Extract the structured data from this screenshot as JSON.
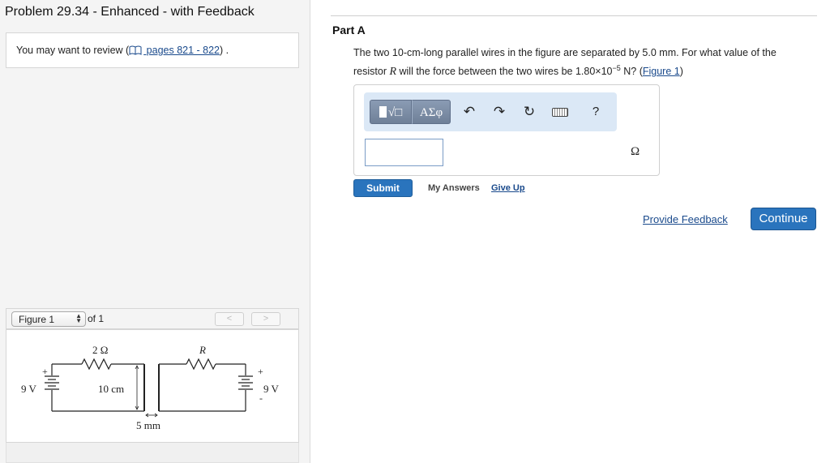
{
  "problem": {
    "title": "Problem 29.34 - Enhanced - with Feedback"
  },
  "review": {
    "prefix": "You may want to review (",
    "link_text": " pages 821 - 822",
    "suffix": ") ."
  },
  "figure_nav": {
    "selected": "Figure 1",
    "of_text": "of 1",
    "prev_label": "<",
    "next_label": ">"
  },
  "figure": {
    "left_resistor_label": "2 Ω",
    "right_resistor_label": "R",
    "left_battery_label": "9 V",
    "right_battery_label": "9 V",
    "plus": "+",
    "minus": "-",
    "wire_length_label": "10 cm",
    "separation_label": "5 mm"
  },
  "part": {
    "title": "Part A"
  },
  "question": {
    "text1": "The two 10-cm-long parallel wires in the figure are separated by 5.0 mm. For what value of the",
    "text2a": "resistor ",
    "var_r": "R",
    "text2b": " will the force between the two wires be 1.80×10",
    "exponent": "−5",
    "text2c": " N? (",
    "figure_link": "Figure 1",
    "text2d": ")"
  },
  "toolbar": {
    "template_label": "√□",
    "greek_label": "ΑΣφ",
    "undo_icon": "↶",
    "redo_icon": "↷",
    "reset_icon": "↻",
    "help_label": "?"
  },
  "answer": {
    "value": "",
    "unit": "Ω"
  },
  "actions": {
    "submit": "Submit",
    "my_answers": "My Answers",
    "give_up": "Give Up",
    "provide_feedback": "Provide Feedback",
    "continue": "Continue"
  },
  "colors": {
    "accent": "#2a74bd",
    "link": "#1a4a8c",
    "toolbar_bg": "#dbe8f6"
  }
}
